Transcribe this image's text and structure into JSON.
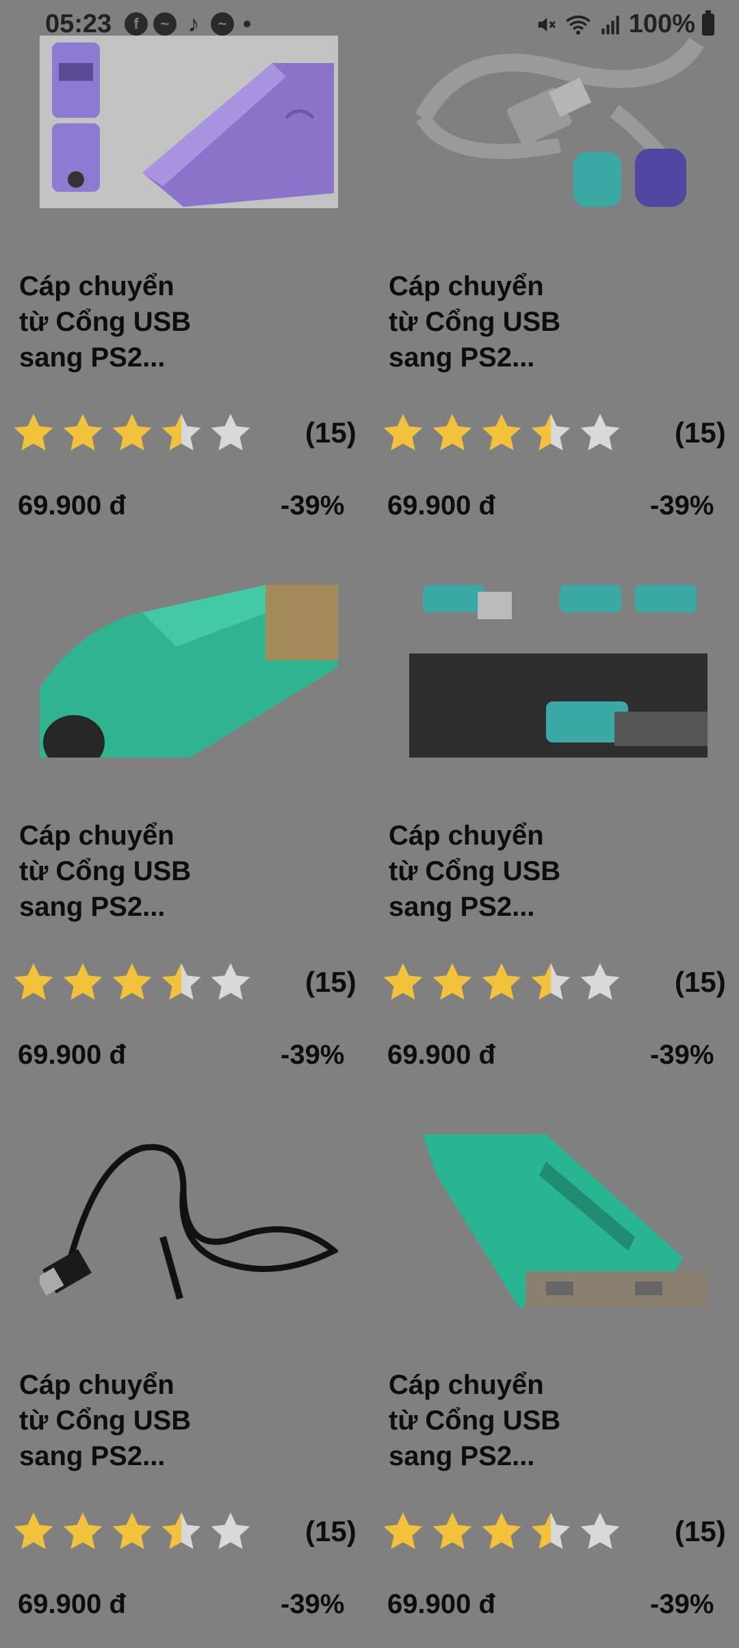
{
  "status_bar": {
    "time": "05:23",
    "notifications": [
      "facebook-icon",
      "messenger-icon",
      "tiktok-icon",
      "messenger-icon"
    ],
    "battery_percent": "100%"
  },
  "products": [
    {
      "title": "Cáp chuyển\ntừ Cổng USB\nsang PS2...",
      "rating": 3.5,
      "reviews": "(15)",
      "price": "69.900 đ",
      "discount": "-39%",
      "image": "purple-usb-ps2-adapter"
    },
    {
      "title": "Cáp chuyển\ntừ Cổng USB\nsang PS2...",
      "rating": 3.5,
      "reviews": "(15)",
      "price": "69.900 đ",
      "discount": "-39%",
      "image": "usb-to-dual-ps2-cable"
    },
    {
      "title": "Cáp chuyển\ntừ Cổng USB\nsang PS2...",
      "rating": 3.5,
      "reviews": "(15)",
      "price": "69.900 đ",
      "discount": "-39%",
      "image": "green-usb-ps2-adapter"
    },
    {
      "title": "Cáp chuyển\ntừ Cổng USB\nsang PS2...",
      "rating": 3.5,
      "reviews": "(15)",
      "price": "69.900 đ",
      "discount": "-39%",
      "image": "adapters-plugged-in"
    },
    {
      "title": "Cáp chuyển\ntừ Cổng USB\nsang PS2...",
      "rating": 3.5,
      "reviews": "(15)",
      "price": "69.900 đ",
      "discount": "-39%",
      "image": "black-usb-cable"
    },
    {
      "title": "Cáp chuyển\ntừ Cổng USB\nsang PS2...",
      "rating": 3.5,
      "reviews": "(15)",
      "price": "69.900 đ",
      "discount": "-39%",
      "image": "green-adapter-closeup"
    }
  ],
  "colors": {
    "overlay": "#808080",
    "star_filled": "#f2c23a",
    "star_empty": "#d9d9d9"
  }
}
